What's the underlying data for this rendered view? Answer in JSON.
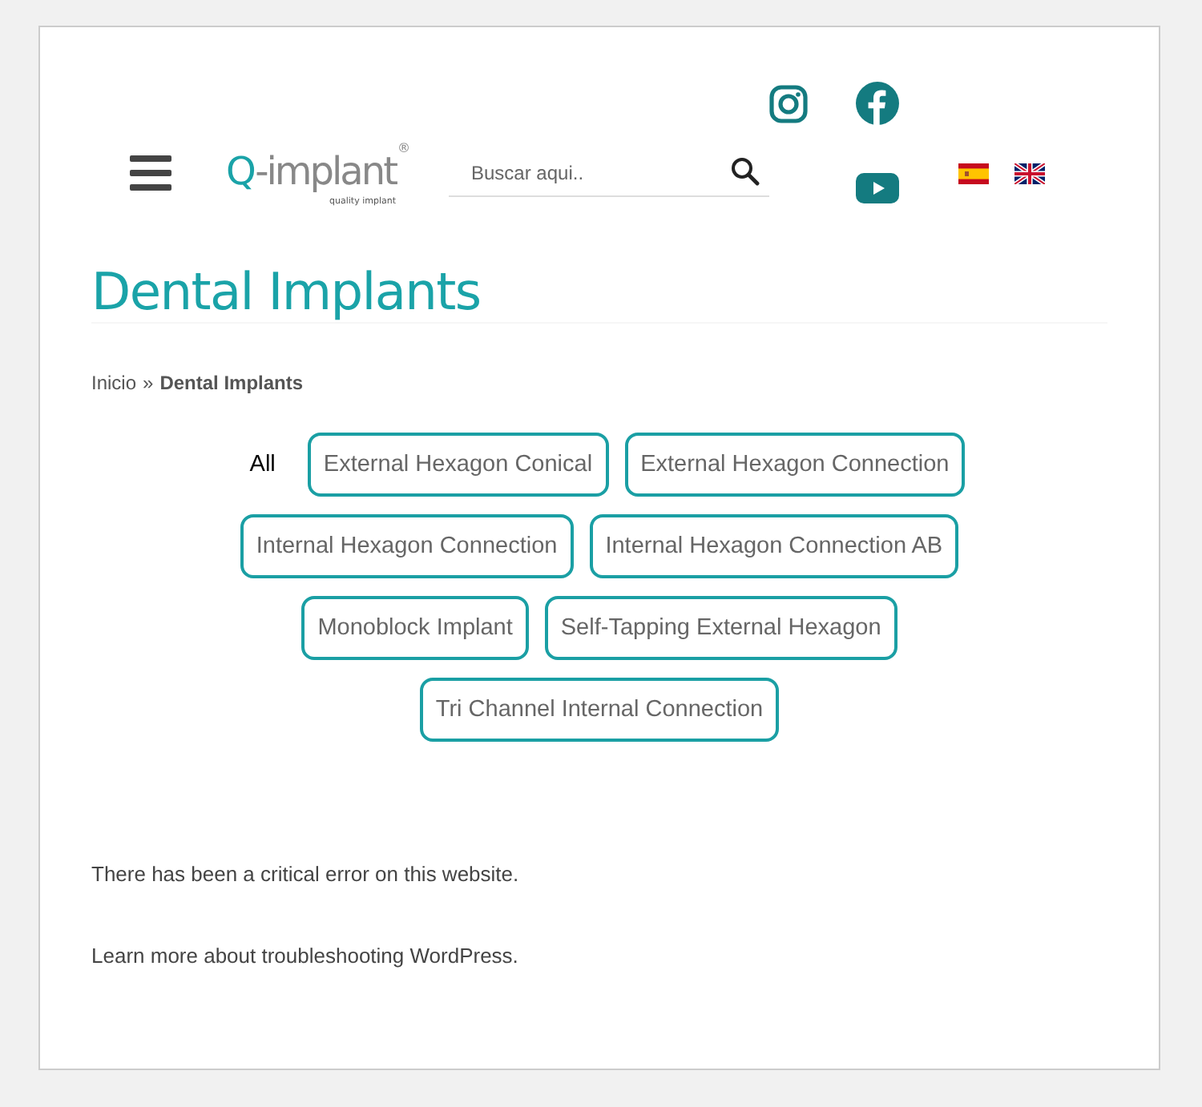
{
  "header": {
    "search": {
      "placeholder": "Buscar aqui.."
    },
    "logo": {
      "wordmark_letter": "Q",
      "wordmark_rest": "-implant",
      "registered": "®",
      "tagline": "quality implant"
    },
    "languages": [
      {
        "kind": "spain"
      },
      {
        "kind": "uk"
      }
    ]
  },
  "title": "Dental Implants",
  "breadcrumb": {
    "home": "Inicio",
    "separator": "»",
    "current": "Dental Implants"
  },
  "filters": [
    {
      "label": "All",
      "selected": true
    },
    {
      "label": "External Hexagon Conical",
      "selected": false
    },
    {
      "label": "External Hexagon Connection",
      "selected": false
    },
    {
      "label": "Internal Hexagon Connection",
      "selected": false
    },
    {
      "label": "Internal Hexagon Connection AB",
      "selected": false
    },
    {
      "label": "Monoblock Implant",
      "selected": false
    },
    {
      "label": "Self-Tapping External Hexagon",
      "selected": false
    },
    {
      "label": "Tri Channel Internal Connection",
      "selected": false
    }
  ],
  "messages": [
    "There has been a critical error on this website.",
    "Learn more about troubleshooting WordPress."
  ]
}
